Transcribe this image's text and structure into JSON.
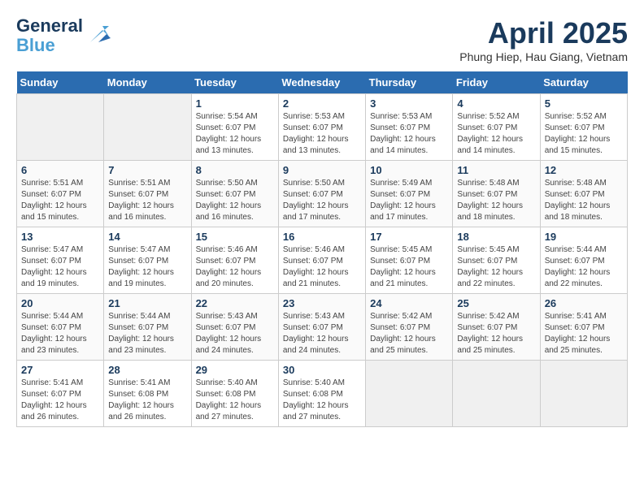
{
  "header": {
    "logo_line1": "General",
    "logo_line2": "Blue",
    "month_title": "April 2025",
    "location": "Phung Hiep, Hau Giang, Vietnam"
  },
  "days_of_week": [
    "Sunday",
    "Monday",
    "Tuesday",
    "Wednesday",
    "Thursday",
    "Friday",
    "Saturday"
  ],
  "weeks": [
    [
      {
        "num": "",
        "info": ""
      },
      {
        "num": "",
        "info": ""
      },
      {
        "num": "1",
        "info": "Sunrise: 5:54 AM\nSunset: 6:07 PM\nDaylight: 12 hours and 13 minutes."
      },
      {
        "num": "2",
        "info": "Sunrise: 5:53 AM\nSunset: 6:07 PM\nDaylight: 12 hours and 13 minutes."
      },
      {
        "num": "3",
        "info": "Sunrise: 5:53 AM\nSunset: 6:07 PM\nDaylight: 12 hours and 14 minutes."
      },
      {
        "num": "4",
        "info": "Sunrise: 5:52 AM\nSunset: 6:07 PM\nDaylight: 12 hours and 14 minutes."
      },
      {
        "num": "5",
        "info": "Sunrise: 5:52 AM\nSunset: 6:07 PM\nDaylight: 12 hours and 15 minutes."
      }
    ],
    [
      {
        "num": "6",
        "info": "Sunrise: 5:51 AM\nSunset: 6:07 PM\nDaylight: 12 hours and 15 minutes."
      },
      {
        "num": "7",
        "info": "Sunrise: 5:51 AM\nSunset: 6:07 PM\nDaylight: 12 hours and 16 minutes."
      },
      {
        "num": "8",
        "info": "Sunrise: 5:50 AM\nSunset: 6:07 PM\nDaylight: 12 hours and 16 minutes."
      },
      {
        "num": "9",
        "info": "Sunrise: 5:50 AM\nSunset: 6:07 PM\nDaylight: 12 hours and 17 minutes."
      },
      {
        "num": "10",
        "info": "Sunrise: 5:49 AM\nSunset: 6:07 PM\nDaylight: 12 hours and 17 minutes."
      },
      {
        "num": "11",
        "info": "Sunrise: 5:48 AM\nSunset: 6:07 PM\nDaylight: 12 hours and 18 minutes."
      },
      {
        "num": "12",
        "info": "Sunrise: 5:48 AM\nSunset: 6:07 PM\nDaylight: 12 hours and 18 minutes."
      }
    ],
    [
      {
        "num": "13",
        "info": "Sunrise: 5:47 AM\nSunset: 6:07 PM\nDaylight: 12 hours and 19 minutes."
      },
      {
        "num": "14",
        "info": "Sunrise: 5:47 AM\nSunset: 6:07 PM\nDaylight: 12 hours and 19 minutes."
      },
      {
        "num": "15",
        "info": "Sunrise: 5:46 AM\nSunset: 6:07 PM\nDaylight: 12 hours and 20 minutes."
      },
      {
        "num": "16",
        "info": "Sunrise: 5:46 AM\nSunset: 6:07 PM\nDaylight: 12 hours and 21 minutes."
      },
      {
        "num": "17",
        "info": "Sunrise: 5:45 AM\nSunset: 6:07 PM\nDaylight: 12 hours and 21 minutes."
      },
      {
        "num": "18",
        "info": "Sunrise: 5:45 AM\nSunset: 6:07 PM\nDaylight: 12 hours and 22 minutes."
      },
      {
        "num": "19",
        "info": "Sunrise: 5:44 AM\nSunset: 6:07 PM\nDaylight: 12 hours and 22 minutes."
      }
    ],
    [
      {
        "num": "20",
        "info": "Sunrise: 5:44 AM\nSunset: 6:07 PM\nDaylight: 12 hours and 23 minutes."
      },
      {
        "num": "21",
        "info": "Sunrise: 5:44 AM\nSunset: 6:07 PM\nDaylight: 12 hours and 23 minutes."
      },
      {
        "num": "22",
        "info": "Sunrise: 5:43 AM\nSunset: 6:07 PM\nDaylight: 12 hours and 24 minutes."
      },
      {
        "num": "23",
        "info": "Sunrise: 5:43 AM\nSunset: 6:07 PM\nDaylight: 12 hours and 24 minutes."
      },
      {
        "num": "24",
        "info": "Sunrise: 5:42 AM\nSunset: 6:07 PM\nDaylight: 12 hours and 25 minutes."
      },
      {
        "num": "25",
        "info": "Sunrise: 5:42 AM\nSunset: 6:07 PM\nDaylight: 12 hours and 25 minutes."
      },
      {
        "num": "26",
        "info": "Sunrise: 5:41 AM\nSunset: 6:07 PM\nDaylight: 12 hours and 25 minutes."
      }
    ],
    [
      {
        "num": "27",
        "info": "Sunrise: 5:41 AM\nSunset: 6:07 PM\nDaylight: 12 hours and 26 minutes."
      },
      {
        "num": "28",
        "info": "Sunrise: 5:41 AM\nSunset: 6:08 PM\nDaylight: 12 hours and 26 minutes."
      },
      {
        "num": "29",
        "info": "Sunrise: 5:40 AM\nSunset: 6:08 PM\nDaylight: 12 hours and 27 minutes."
      },
      {
        "num": "30",
        "info": "Sunrise: 5:40 AM\nSunset: 6:08 PM\nDaylight: 12 hours and 27 minutes."
      },
      {
        "num": "",
        "info": ""
      },
      {
        "num": "",
        "info": ""
      },
      {
        "num": "",
        "info": ""
      }
    ]
  ]
}
